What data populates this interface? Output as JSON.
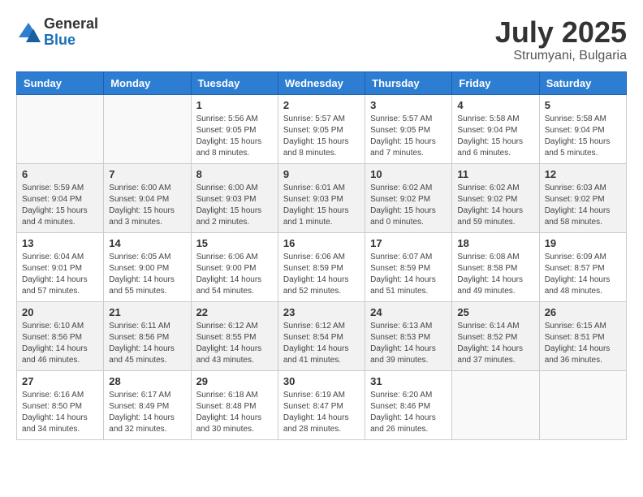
{
  "logo": {
    "general": "General",
    "blue": "Blue"
  },
  "title": "July 2025",
  "subtitle": "Strumyani, Bulgaria",
  "days_of_week": [
    "Sunday",
    "Monday",
    "Tuesday",
    "Wednesday",
    "Thursday",
    "Friday",
    "Saturday"
  ],
  "weeks": [
    [
      {
        "day": "",
        "sunrise": "",
        "sunset": "",
        "daylight": "",
        "empty": true
      },
      {
        "day": "",
        "sunrise": "",
        "sunset": "",
        "daylight": "",
        "empty": true
      },
      {
        "day": "1",
        "sunrise": "Sunrise: 5:56 AM",
        "sunset": "Sunset: 9:05 PM",
        "daylight": "Daylight: 15 hours and 8 minutes."
      },
      {
        "day": "2",
        "sunrise": "Sunrise: 5:57 AM",
        "sunset": "Sunset: 9:05 PM",
        "daylight": "Daylight: 15 hours and 8 minutes."
      },
      {
        "day": "3",
        "sunrise": "Sunrise: 5:57 AM",
        "sunset": "Sunset: 9:05 PM",
        "daylight": "Daylight: 15 hours and 7 minutes."
      },
      {
        "day": "4",
        "sunrise": "Sunrise: 5:58 AM",
        "sunset": "Sunset: 9:04 PM",
        "daylight": "Daylight: 15 hours and 6 minutes."
      },
      {
        "day": "5",
        "sunrise": "Sunrise: 5:58 AM",
        "sunset": "Sunset: 9:04 PM",
        "daylight": "Daylight: 15 hours and 5 minutes."
      }
    ],
    [
      {
        "day": "6",
        "sunrise": "Sunrise: 5:59 AM",
        "sunset": "Sunset: 9:04 PM",
        "daylight": "Daylight: 15 hours and 4 minutes."
      },
      {
        "day": "7",
        "sunrise": "Sunrise: 6:00 AM",
        "sunset": "Sunset: 9:04 PM",
        "daylight": "Daylight: 15 hours and 3 minutes."
      },
      {
        "day": "8",
        "sunrise": "Sunrise: 6:00 AM",
        "sunset": "Sunset: 9:03 PM",
        "daylight": "Daylight: 15 hours and 2 minutes."
      },
      {
        "day": "9",
        "sunrise": "Sunrise: 6:01 AM",
        "sunset": "Sunset: 9:03 PM",
        "daylight": "Daylight: 15 hours and 1 minute."
      },
      {
        "day": "10",
        "sunrise": "Sunrise: 6:02 AM",
        "sunset": "Sunset: 9:02 PM",
        "daylight": "Daylight: 15 hours and 0 minutes."
      },
      {
        "day": "11",
        "sunrise": "Sunrise: 6:02 AM",
        "sunset": "Sunset: 9:02 PM",
        "daylight": "Daylight: 14 hours and 59 minutes."
      },
      {
        "day": "12",
        "sunrise": "Sunrise: 6:03 AM",
        "sunset": "Sunset: 9:02 PM",
        "daylight": "Daylight: 14 hours and 58 minutes."
      }
    ],
    [
      {
        "day": "13",
        "sunrise": "Sunrise: 6:04 AM",
        "sunset": "Sunset: 9:01 PM",
        "daylight": "Daylight: 14 hours and 57 minutes."
      },
      {
        "day": "14",
        "sunrise": "Sunrise: 6:05 AM",
        "sunset": "Sunset: 9:00 PM",
        "daylight": "Daylight: 14 hours and 55 minutes."
      },
      {
        "day": "15",
        "sunrise": "Sunrise: 6:06 AM",
        "sunset": "Sunset: 9:00 PM",
        "daylight": "Daylight: 14 hours and 54 minutes."
      },
      {
        "day": "16",
        "sunrise": "Sunrise: 6:06 AM",
        "sunset": "Sunset: 8:59 PM",
        "daylight": "Daylight: 14 hours and 52 minutes."
      },
      {
        "day": "17",
        "sunrise": "Sunrise: 6:07 AM",
        "sunset": "Sunset: 8:59 PM",
        "daylight": "Daylight: 14 hours and 51 minutes."
      },
      {
        "day": "18",
        "sunrise": "Sunrise: 6:08 AM",
        "sunset": "Sunset: 8:58 PM",
        "daylight": "Daylight: 14 hours and 49 minutes."
      },
      {
        "day": "19",
        "sunrise": "Sunrise: 6:09 AM",
        "sunset": "Sunset: 8:57 PM",
        "daylight": "Daylight: 14 hours and 48 minutes."
      }
    ],
    [
      {
        "day": "20",
        "sunrise": "Sunrise: 6:10 AM",
        "sunset": "Sunset: 8:56 PM",
        "daylight": "Daylight: 14 hours and 46 minutes."
      },
      {
        "day": "21",
        "sunrise": "Sunrise: 6:11 AM",
        "sunset": "Sunset: 8:56 PM",
        "daylight": "Daylight: 14 hours and 45 minutes."
      },
      {
        "day": "22",
        "sunrise": "Sunrise: 6:12 AM",
        "sunset": "Sunset: 8:55 PM",
        "daylight": "Daylight: 14 hours and 43 minutes."
      },
      {
        "day": "23",
        "sunrise": "Sunrise: 6:12 AM",
        "sunset": "Sunset: 8:54 PM",
        "daylight": "Daylight: 14 hours and 41 minutes."
      },
      {
        "day": "24",
        "sunrise": "Sunrise: 6:13 AM",
        "sunset": "Sunset: 8:53 PM",
        "daylight": "Daylight: 14 hours and 39 minutes."
      },
      {
        "day": "25",
        "sunrise": "Sunrise: 6:14 AM",
        "sunset": "Sunset: 8:52 PM",
        "daylight": "Daylight: 14 hours and 37 minutes."
      },
      {
        "day": "26",
        "sunrise": "Sunrise: 6:15 AM",
        "sunset": "Sunset: 8:51 PM",
        "daylight": "Daylight: 14 hours and 36 minutes."
      }
    ],
    [
      {
        "day": "27",
        "sunrise": "Sunrise: 6:16 AM",
        "sunset": "Sunset: 8:50 PM",
        "daylight": "Daylight: 14 hours and 34 minutes."
      },
      {
        "day": "28",
        "sunrise": "Sunrise: 6:17 AM",
        "sunset": "Sunset: 8:49 PM",
        "daylight": "Daylight: 14 hours and 32 minutes."
      },
      {
        "day": "29",
        "sunrise": "Sunrise: 6:18 AM",
        "sunset": "Sunset: 8:48 PM",
        "daylight": "Daylight: 14 hours and 30 minutes."
      },
      {
        "day": "30",
        "sunrise": "Sunrise: 6:19 AM",
        "sunset": "Sunset: 8:47 PM",
        "daylight": "Daylight: 14 hours and 28 minutes."
      },
      {
        "day": "31",
        "sunrise": "Sunrise: 6:20 AM",
        "sunset": "Sunset: 8:46 PM",
        "daylight": "Daylight: 14 hours and 26 minutes."
      },
      {
        "day": "",
        "sunrise": "",
        "sunset": "",
        "daylight": "",
        "empty": true
      },
      {
        "day": "",
        "sunrise": "",
        "sunset": "",
        "daylight": "",
        "empty": true
      }
    ]
  ]
}
